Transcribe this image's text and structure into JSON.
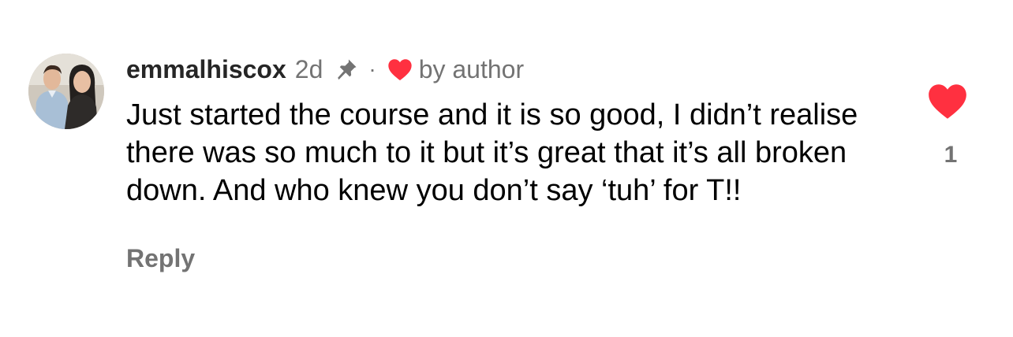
{
  "comment": {
    "username": "emmalhiscox",
    "time": "2d",
    "separator": "·",
    "liked_by_label": "by author",
    "text": "Just started the course and it is so good, I didn’t realise there was so much to it but it’s great that it’s all broken down. And who knew you don’t say ‘tuh’ for T!!",
    "reply_label": "Reply",
    "like_count": "1"
  },
  "icons": {
    "pin": "pin-icon",
    "liked_by_author": "heart-icon",
    "like": "heart-icon"
  },
  "colors": {
    "heart_red": "#ff3040",
    "meta_gray": "#737373",
    "username": "#262626",
    "text": "#000000",
    "background": "#ffffff"
  }
}
